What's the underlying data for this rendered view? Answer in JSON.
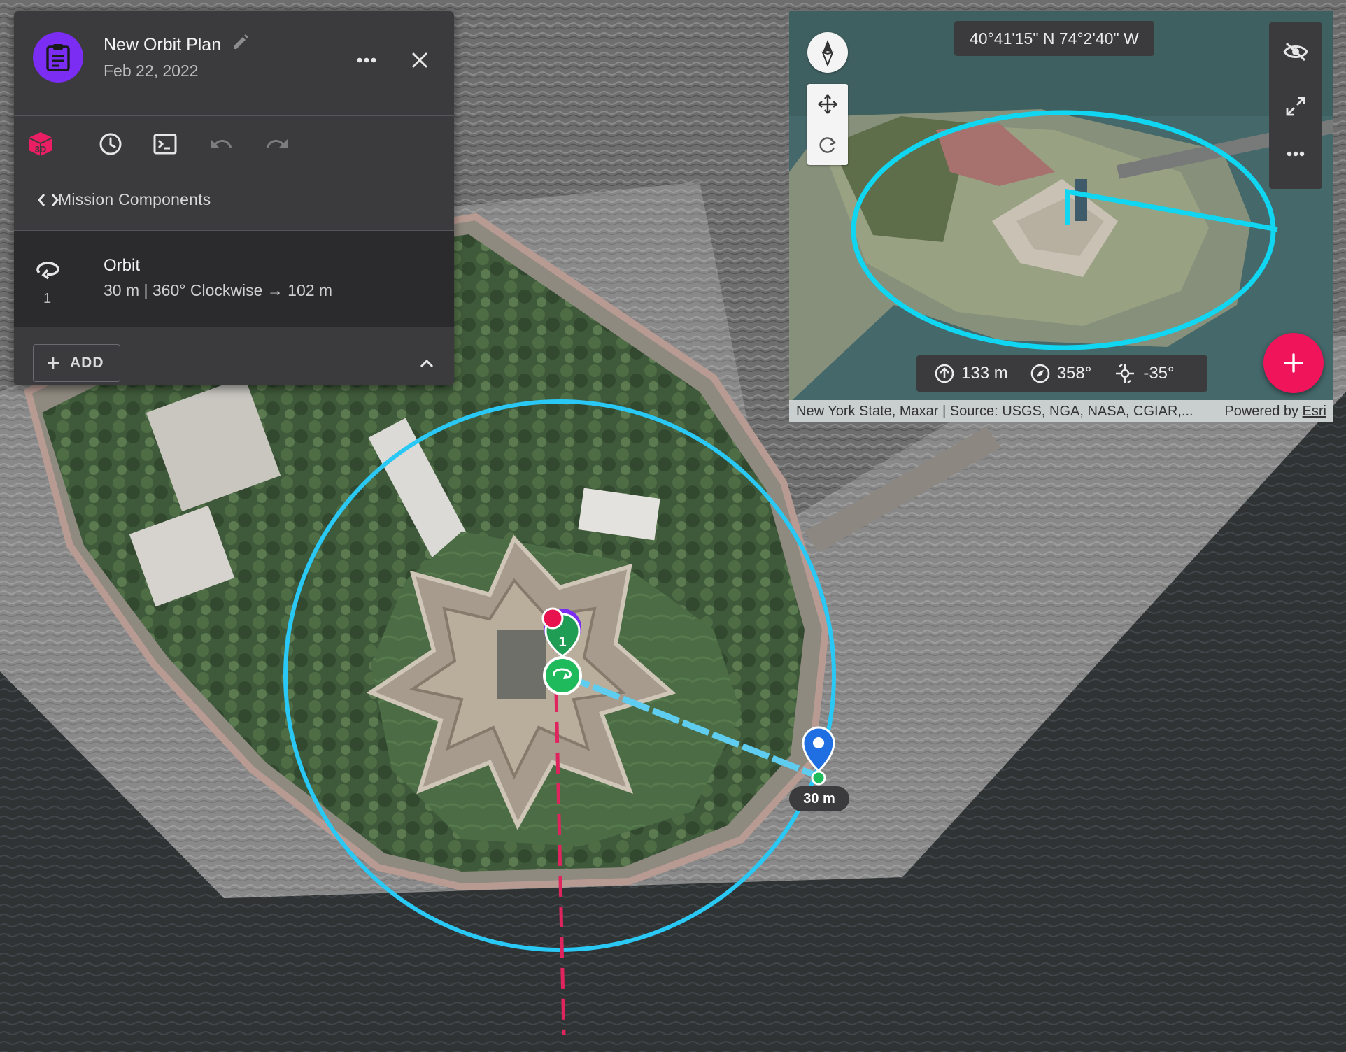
{
  "plan": {
    "title": "New Orbit Plan",
    "date": "Feb 22, 2022"
  },
  "toolbar": {
    "icons": [
      "3d-icon",
      "clock-icon",
      "terminal-icon",
      "undo-icon",
      "redo-icon"
    ],
    "active_color": "#e91e63"
  },
  "mission_components": {
    "label": "Mission Components"
  },
  "orbit": {
    "index": "1",
    "title": "Orbit",
    "detail": "30 m | 360° Clockwise → 102 m"
  },
  "add_button": {
    "label": "ADD"
  },
  "preview": {
    "coordinates": "40°41'15\" N 74°2'40\" W",
    "altitude": "133 m",
    "heading": "358°",
    "gimbal": "-35°",
    "attribution": "New York State, Maxar | Source: USGS, NGA, NASA, CGIAR,...",
    "powered_by_prefix": "Powered by ",
    "powered_by_link": "Esri"
  },
  "map": {
    "waypoint_index": "1",
    "radius_label": "30 m",
    "orbit_color": "#29c8f5",
    "accent": "#7b2df4"
  }
}
